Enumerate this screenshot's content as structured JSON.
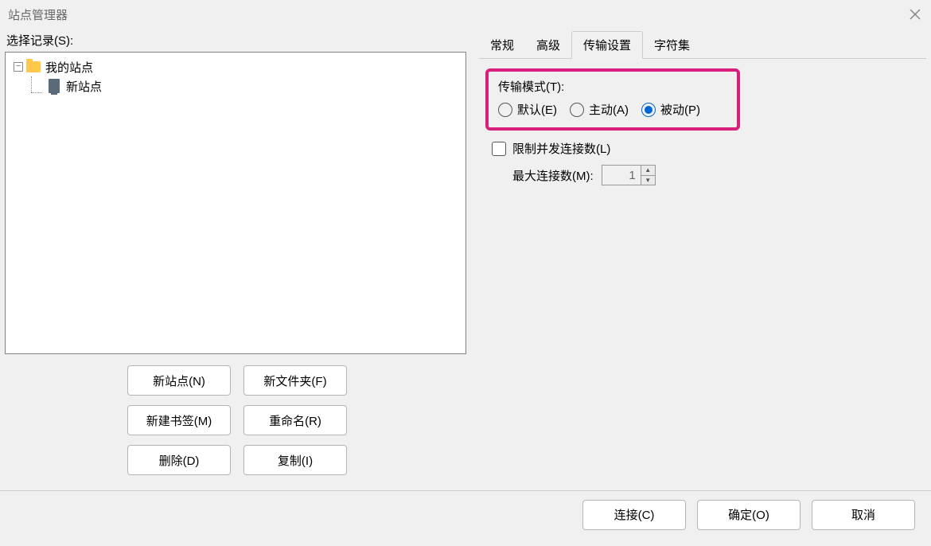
{
  "window": {
    "title": "站点管理器"
  },
  "left": {
    "select_label": "选择记录(S):",
    "tree": {
      "root": {
        "label": "我的站点",
        "toggle": "−"
      },
      "child": {
        "label": "新站点"
      }
    },
    "buttons": {
      "new_site": "新站点(N)",
      "new_folder": "新文件夹(F)",
      "new_bookmark": "新建书签(M)",
      "rename": "重命名(R)",
      "delete": "删除(D)",
      "copy": "复制(I)"
    }
  },
  "tabs": {
    "general": "常规",
    "advanced": "高级",
    "transfer": "传输设置",
    "charset": "字符集",
    "active": "transfer"
  },
  "transfer_settings": {
    "mode_label": "传输模式(T):",
    "radio_default": "默认(E)",
    "radio_active": "主动(A)",
    "radio_passive": "被动(P)",
    "selected": "passive",
    "limit_label": "限制并发连接数(L)",
    "limit_checked": false,
    "max_conn_label": "最大连接数(M):",
    "max_conn_value": "1"
  },
  "footer": {
    "connect": "连接(C)",
    "ok": "确定(O)",
    "cancel": "取消"
  }
}
